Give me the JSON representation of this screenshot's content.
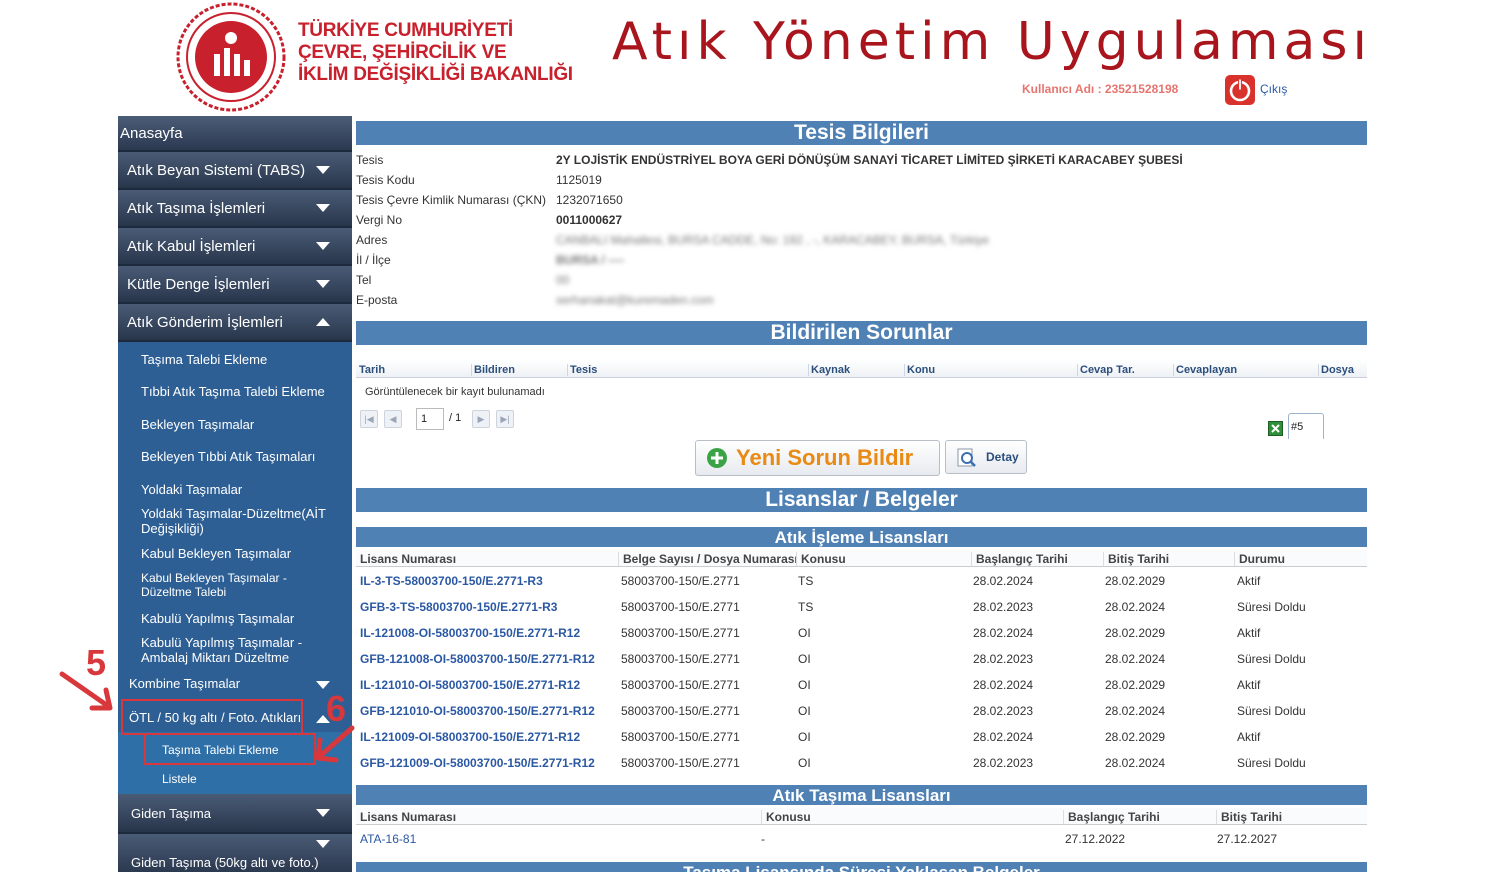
{
  "header": {
    "ministry_line1": "TÜRKİYE CUMHURİYETİ",
    "ministry_line2": "ÇEVRE, ŞEHİRCİLİK VE",
    "ministry_line3": "İKLİM DEĞİŞİKLİĞİ BAKANLIĞI",
    "app_title": "Atık Yönetim Uygulaması",
    "user_label": "Kullanıcı Adı : 23521528198",
    "logout_label": "Çıkış"
  },
  "sidebar": {
    "home": "Anasayfa",
    "items": [
      "Atık Beyan Sistemi (TABS)",
      "Atık Taşıma İşlemleri",
      "Atık Kabul İşlemleri",
      "Kütle Denge İşlemleri",
      "Atık Gönderim İşlemleri"
    ],
    "subitems": [
      "Taşıma Talebi Ekleme",
      "Tıbbi Atık Taşıma Talebi Ekleme",
      "Bekleyen Taşımalar",
      "Bekleyen Tıbbi Atık Taşımaları",
      "Yoldaki Taşımalar",
      "Yoldaki Taşımalar-Düzeltme(AİT Değişikliği)",
      "Kabul Bekleyen Taşımalar",
      "Kabul Bekleyen Taşımalar - Düzeltme Talebi",
      "Kabulü Yapılmış Taşımalar",
      "Kabulü Yapılmış Taşımalar - Ambalaj Miktarı Düzeltme"
    ],
    "kombine": "Kombine Taşımalar",
    "otl": "ÖTL / 50 kg altı / Foto. Atıkları",
    "otl_sub1": "Taşıma Talebi Ekleme",
    "otl_sub2": "Listele",
    "giden": "Giden Taşıma",
    "giden50": "Giden Taşıma (50kg altı ve foto.)"
  },
  "annotations": {
    "step5": "5",
    "step6": "6"
  },
  "tesis": {
    "title": "Tesis Bilgileri",
    "rows": [
      {
        "label": "Tesis",
        "value": "2Y LOJİSTİK ENDÜSTRİYEL BOYA GERİ DÖNÜŞÜM SANAYİ TİCARET LİMİTED ŞİRKETİ KARACABEY ŞUBESİ"
      },
      {
        "label": "Tesis Kodu",
        "value": "1125019"
      },
      {
        "label": "Tesis Çevre Kimlik Numarası (ÇKN)",
        "value": "1232071650"
      },
      {
        "label": "Vergi No",
        "value": "0011000627"
      },
      {
        "label": "Adres",
        "value": "CANBALI Mahallesi, BURSA CADDE, No: 192 , -, KARACABEY, BURSA, Türkiye"
      },
      {
        "label": "İl / İlçe",
        "value": "BURSA / ----"
      },
      {
        "label": "Tel",
        "value": "00"
      },
      {
        "label": "E-posta",
        "value": "serhanakat@kuremaden.com"
      }
    ]
  },
  "sorunlar": {
    "title": "Bildirilen Sorunlar",
    "columns": [
      "Tarih",
      "Bildiren",
      "Tesis",
      "Kaynak",
      "Konu",
      "Cevap Tar.",
      "Cevaplayan",
      "Dosya"
    ],
    "empty": "Görüntülenecek bir kayıt bulunamadı",
    "page": "1",
    "total": "/ 1",
    "export_count": "#5",
    "new_button": "Yeni Sorun Bildir",
    "detail_button": "Detay"
  },
  "lisanslar": {
    "title": "Lisanslar / Belgeler",
    "isleme_title": "Atık İşleme Lisansları",
    "isleme_columns": [
      "Lisans Numarası",
      "Belge Sayısı / Dosya Numarası",
      "Konusu",
      "Başlangıç Tarihi",
      "Bitiş Tarihi",
      "Durumu"
    ],
    "isleme_rows": [
      [
        "IL-3-TS-58003700-150/E.2771-R3",
        "58003700-150/E.2771",
        "TS",
        "28.02.2024",
        "28.02.2029",
        "Aktif"
      ],
      [
        "GFB-3-TS-58003700-150/E.2771-R3",
        "58003700-150/E.2771",
        "TS",
        "28.02.2023",
        "28.02.2024",
        "Süresi Doldu"
      ],
      [
        "IL-121008-OI-58003700-150/E.2771-R12",
        "58003700-150/E.2771",
        "OI",
        "28.02.2024",
        "28.02.2029",
        "Aktif"
      ],
      [
        "GFB-121008-OI-58003700-150/E.2771-R12",
        "58003700-150/E.2771",
        "OI",
        "28.02.2023",
        "28.02.2024",
        "Süresi Doldu"
      ],
      [
        "IL-121010-OI-58003700-150/E.2771-R12",
        "58003700-150/E.2771",
        "OI",
        "28.02.2024",
        "28.02.2029",
        "Aktif"
      ],
      [
        "GFB-121010-OI-58003700-150/E.2771-R12",
        "58003700-150/E.2771",
        "OI",
        "28.02.2023",
        "28.02.2024",
        "Süresi Doldu"
      ],
      [
        "IL-121009-OI-58003700-150/E.2771-R12",
        "58003700-150/E.2771",
        "OI",
        "28.02.2024",
        "28.02.2029",
        "Aktif"
      ],
      [
        "GFB-121009-OI-58003700-150/E.2771-R12",
        "58003700-150/E.2771",
        "OI",
        "28.02.2023",
        "28.02.2024",
        "Süresi Doldu"
      ]
    ],
    "tasima_title": "Atık Taşıma Lisansları",
    "tasima_columns": [
      "Lisans Numarası",
      "Konusu",
      "Başlangıç Tarihi",
      "Bitiş Tarihi"
    ],
    "tasima_rows": [
      [
        "ATA-16-81",
        "-",
        "27.12.2022",
        "27.12.2027"
      ]
    ],
    "expiring_title": "Taşıma Lisansında Süresi Yaklaşan Belgeler"
  },
  "colors": {
    "accent": "#4f81b5",
    "brand_red": "#c8202c",
    "sidebar": "#2e5f94",
    "annotation": "#d8373b"
  }
}
